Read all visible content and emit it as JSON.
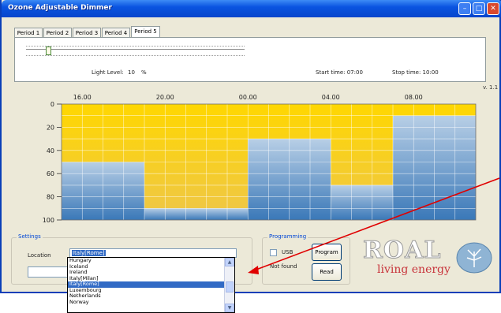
{
  "window": {
    "title": "Ozone Adjustable Dimmer"
  },
  "tabs": [
    "Period 1",
    "Period 2",
    "Period 3",
    "Period 4",
    "Period 5"
  ],
  "active_tab": "Period 5",
  "period": {
    "light_level_label": "Light Level:",
    "light_level_value": "10",
    "light_level_unit": "%",
    "light_level_fraction": 0.1,
    "start_time": "Start time: 07:00",
    "stop_time": "Stop time: 10:00"
  },
  "version": "v. 1.1",
  "chart_data": {
    "type": "area",
    "x_tick_labels": [
      "16.00",
      "20.00",
      "00.00",
      "04.00",
      "08.00"
    ],
    "x_start_hour": 15,
    "x_end_hour": 35,
    "y_tick_labels": [
      "0",
      "20",
      "40",
      "60",
      "80",
      "100"
    ],
    "ylim": [
      0,
      100
    ],
    "y_inverted": true,
    "steps": [
      {
        "from": 15,
        "to": 19,
        "level": 50
      },
      {
        "from": 19,
        "to": 24,
        "level": 90
      },
      {
        "from": 24,
        "to": 28,
        "level": 30
      },
      {
        "from": 28,
        "to": 31,
        "level": 70
      },
      {
        "from": 31,
        "to": 35,
        "level": 10
      }
    ],
    "colors": {
      "fill_top": "#ffd700",
      "fill_bottom": "#eec64a",
      "bar_top": "#b8cfe6",
      "bar_bottom": "#3a78b8",
      "grid": "#ffffff"
    }
  },
  "settings": {
    "group_title": "Settings",
    "location_label": "Location",
    "location_value": "Italy[Rome]",
    "dropdown_items": [
      "Hungary",
      "Iceland",
      "Ireland",
      "Italy[Milan]",
      "Italy[Rome]",
      "Luxembourg",
      "Netherlands",
      "Norway"
    ],
    "selected_item": "Italy[Rome]"
  },
  "programming": {
    "group_title": "Programming",
    "usb_label": "USB",
    "status": "Not found",
    "program_button": "Program",
    "read_button": "Read"
  },
  "logo": {
    "brand": "ROAL",
    "tagline": "living energy"
  },
  "annotation_color": "#e00000"
}
